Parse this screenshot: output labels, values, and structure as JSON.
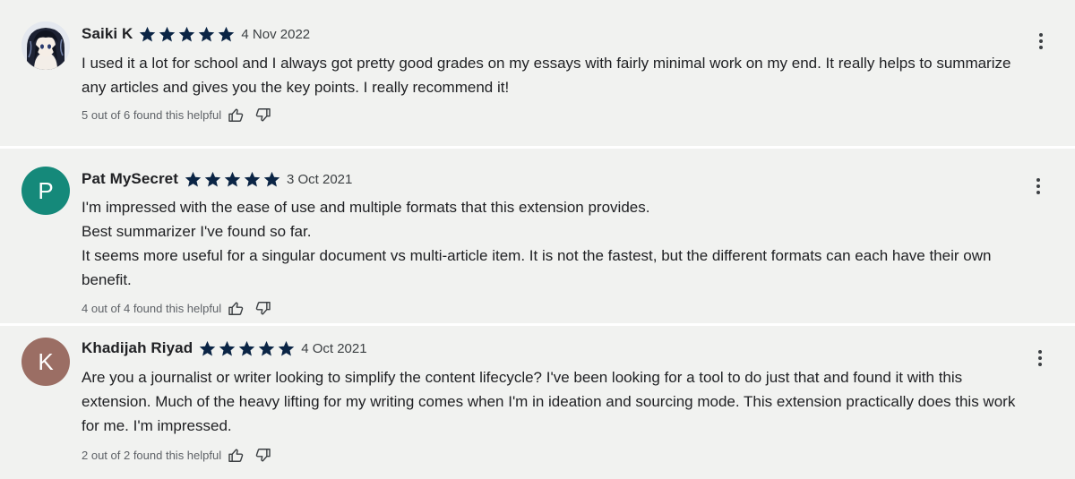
{
  "reviews": [
    {
      "author": "Saiki K",
      "avatar_type": "image",
      "avatar_letter": "",
      "avatar_color": "",
      "rating": 5,
      "date": "4 Nov 2022",
      "paragraphs": [
        "I used it a lot for school and I always got pretty good grades on my essays with fairly minimal work on my end. It really helps to summarize any articles and gives you the key points. I really recommend it!"
      ],
      "helpful_text": "5 out of 6 found this helpful"
    },
    {
      "author": "Pat MySecret",
      "avatar_type": "letter",
      "avatar_letter": "P",
      "avatar_color": "#15897a",
      "rating": 5,
      "date": "3 Oct 2021",
      "paragraphs": [
        "I'm impressed with the ease of use and multiple formats that this extension provides.",
        "Best summarizer I've found so far.",
        "It seems more useful for a singular document vs multi-article item. It is not the fastest, but the different formats can each have their own benefit."
      ],
      "helpful_text": "4 out of 4 found this helpful"
    },
    {
      "author": "Khadijah Riyad",
      "avatar_type": "letter",
      "avatar_letter": "K",
      "avatar_color": "#9b6e64",
      "rating": 5,
      "date": "4 Oct 2021",
      "paragraphs": [
        "Are you a journalist or writer looking to simplify the content lifecycle? I've been looking for a tool to do just that and found it with this extension. Much of the heavy lifting for my writing comes when I'm in ideation and sourcing mode. This extension practically does this work for me. I'm impressed."
      ],
      "helpful_text": "2 out of 2 found this helpful"
    }
  ],
  "icons": {
    "star": "star-icon",
    "thumbs_up": "thumbs-up-icon",
    "thumbs_down": "thumbs-down-icon",
    "more": "more-vert-icon"
  },
  "colors": {
    "star": "#0b2545",
    "card_background": "#f1f2f0",
    "icon": "#5f6368"
  }
}
